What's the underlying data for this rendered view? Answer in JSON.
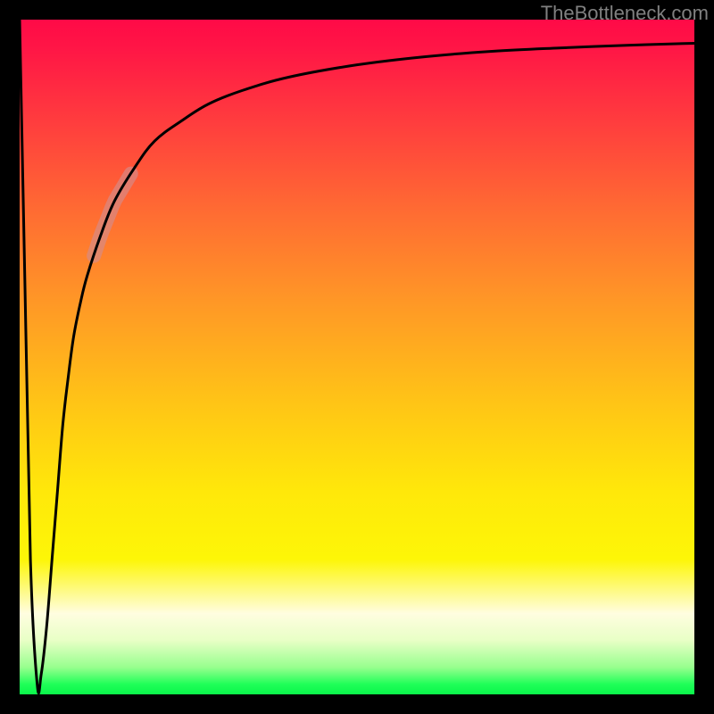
{
  "watermark": "TheBottleneck.com",
  "chart_data": {
    "type": "line",
    "title": "",
    "xlabel": "",
    "ylabel": "",
    "xlim": [
      0,
      100
    ],
    "ylim": [
      0,
      100
    ],
    "grid": false,
    "series": [
      {
        "name": "main-curve",
        "x": [
          0,
          0.8,
          1.6,
          2.6,
          3.2,
          4.0,
          4.8,
          5.6,
          6.4,
          7.2,
          8.0,
          9.0,
          10.0,
          12.0,
          14.0,
          17.0,
          20.0,
          24.0,
          28.0,
          33.0,
          40.0,
          50.0,
          60.0,
          70.0,
          80.0,
          90.0,
          100.0
        ],
        "y": [
          100,
          60,
          20,
          1.5,
          3,
          10,
          20,
          30,
          40,
          47,
          53,
          58,
          62,
          68,
          73,
          78,
          82,
          85,
          87.5,
          89.5,
          91.5,
          93.3,
          94.5,
          95.3,
          95.8,
          96.2,
          96.5
        ]
      }
    ],
    "highlight": {
      "series": "main-curve",
      "x_range": [
        11.0,
        16.5
      ],
      "color": "#d48c8c",
      "opacity": 0.65
    },
    "background_gradient": {
      "type": "vertical",
      "stops": [
        {
          "pos": 0.0,
          "color": "#ff0a47"
        },
        {
          "pos": 0.28,
          "color": "#ff6a33"
        },
        {
          "pos": 0.57,
          "color": "#ffc516"
        },
        {
          "pos": 0.8,
          "color": "#fdf607"
        },
        {
          "pos": 0.92,
          "color": "#e8ffc6"
        },
        {
          "pos": 1.0,
          "color": "#0af54a"
        }
      ]
    }
  }
}
